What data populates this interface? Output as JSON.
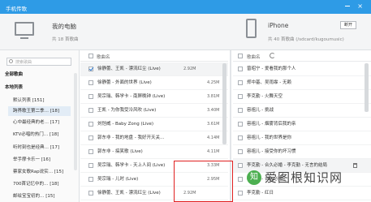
{
  "titlebar": {
    "title": "手机传歌",
    "close_glyph": "×"
  },
  "pc": {
    "name": "我的电脑",
    "sub": "共 18 首歌曲"
  },
  "phone": {
    "name": "iPhone",
    "sub": "共 40 首歌曲 (/sdcard/kugoumusic)",
    "disconnect_label": "断开"
  },
  "sidebar": {
    "search_placeholder": "搜索歌曲",
    "all_songs": "全部歌曲",
    "local_list": "本地列表",
    "items": [
      {
        "label": "默认列表 [151]",
        "selected": false
      },
      {
        "label": "跨界歌王第二季… [18]",
        "selected": true
      },
      {
        "label": "心中最经典的老… [17]",
        "selected": false
      },
      {
        "label": "KTV必唱的热门… [18]",
        "selected": false
      },
      {
        "label": "听时刻也是经典… [17]",
        "selected": false
      },
      {
        "label": "举手摩卡乐一 [16]",
        "selected": false
      },
      {
        "label": "蔡家女歌Rap说实… [15]",
        "selected": false
      },
      {
        "label": "700首记忆中的… [18]",
        "selected": false
      },
      {
        "label": "邮绘宝宝初的… [15]",
        "selected": false
      }
    ]
  },
  "left_list": {
    "header": "歌曲名",
    "rows": [
      {
        "name": "徐静蕾、王凯 - 漂流红尘 (Live)",
        "size": "2.92M",
        "checked": true,
        "highlight": true
      },
      {
        "name": "徐静蕾 - 外面的世界 (Live)",
        "size": "4.25M",
        "checked": false,
        "highlight": false
      },
      {
        "name": "吴宗瑞、韩学卡 - 南屏晚钟 (Live)",
        "size": "3.81M",
        "checked": false,
        "highlight": false
      },
      {
        "name": "王凯 - 为你我受冷风吹 (Live)",
        "size": "3.40M",
        "checked": false,
        "highlight": false
      },
      {
        "name": "刘恺威 - Baby Zong (Live)",
        "size": "3.61M",
        "checked": false,
        "highlight": false
      },
      {
        "name": "郭东非 - 我的地盘 - 我好开天关…",
        "size": "4.14M",
        "checked": false,
        "highlight": false
      },
      {
        "name": "郭东非 - 搞笑歌 (Live)",
        "size": "4.11M",
        "checked": false,
        "highlight": false
      },
      {
        "name": "吴宗瑞、韩学卡 - 天上人间 (Live)",
        "size": "3.33M",
        "checked": false,
        "highlight": false
      },
      {
        "name": "吴宗瑞 - 儿时 (Live)",
        "size": "2.95M",
        "checked": false,
        "highlight": false
      },
      {
        "name": "徐静蕾、王凯 - 漂流红尘 (Live)",
        "size": "2.92M",
        "checked": false,
        "highlight": false
      }
    ]
  },
  "right_list": {
    "header": "歌曲名",
    "rows": [
      {
        "name": "曾昭宁 - 爱看我的那个人",
        "highlight": false
      },
      {
        "name": "郑中基、吴雨霏 - 无赖",
        "highlight": false
      },
      {
        "name": "李克勤 - 火舞天空",
        "highlight": false
      },
      {
        "name": "容祖儿 - 挑战",
        "highlight": false
      },
      {
        "name": "容祖儿 - 烟雾背后我的亲",
        "highlight": false
      },
      {
        "name": "容祖儿 - 我的世界是你",
        "highlight": false
      },
      {
        "name": "容祖儿 - 接受你的坏习惯",
        "highlight": false
      },
      {
        "name": "李克勤 - 合久必婚 - 李克勤 - 无言的结局",
        "highlight": true
      },
      {
        "name": "李克勤 - 合久必婚",
        "highlight": false
      },
      {
        "name": "李克勤 - 红日",
        "highlight": false
      },
      {
        "name": "李克勤 - 月半小夜曲",
        "highlight": false
      }
    ]
  },
  "watermark": {
    "logo": "知",
    "text": "爱图根知识网"
  },
  "colors": {
    "accent": "#2e9be6",
    "highlight_box": "#e02020"
  }
}
